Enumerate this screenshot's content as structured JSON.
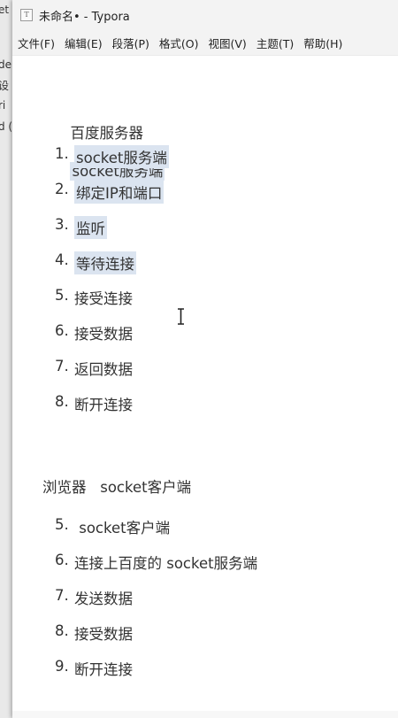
{
  "background_window": {
    "fragments": [
      "et",
      "de",
      "设",
      "ri",
      "d (",
      "设"
    ]
  },
  "titlebar": {
    "icon_glyph": "T",
    "title": "未命名• - Typora"
  },
  "menu": [
    "文件(F)",
    "编辑(E)",
    "段落(P)",
    "格式(O)",
    "视图(V)",
    "主题(T)",
    "帮助(H)"
  ],
  "document": {
    "section1": {
      "heading_part1": "百度服务器",
      "heading_part2": "socket服务端",
      "items": [
        {
          "num": "1.",
          "text": "socket服务端"
        },
        {
          "num": "2.",
          "text": "绑定IP和端口"
        },
        {
          "num": "3.",
          "text": "监听"
        },
        {
          "num": "4.",
          "text": "等待连接"
        },
        {
          "num": "5.",
          "text": "接受连接"
        },
        {
          "num": "6.",
          "text": "接受数据"
        },
        {
          "num": "7.",
          "text": "返回数据"
        },
        {
          "num": "8.",
          "text": "断开连接"
        }
      ]
    },
    "section2": {
      "heading": "浏览器   socket客户端",
      "items": [
        {
          "num": "5.",
          "text": " socket客户端"
        },
        {
          "num": "6.",
          "text": "连接上百度的 socket服务端"
        },
        {
          "num": "7.",
          "text": "发送数据"
        },
        {
          "num": "8.",
          "text": "接受数据"
        },
        {
          "num": "9.",
          "text": "断开连接"
        }
      ]
    }
  },
  "colors": {
    "selection": "#dbe4f0",
    "chrome": "#f3f3f3",
    "text": "#333333"
  },
  "icons": {
    "cursor": "text-cursor-icon",
    "app": "typora-app-icon"
  }
}
